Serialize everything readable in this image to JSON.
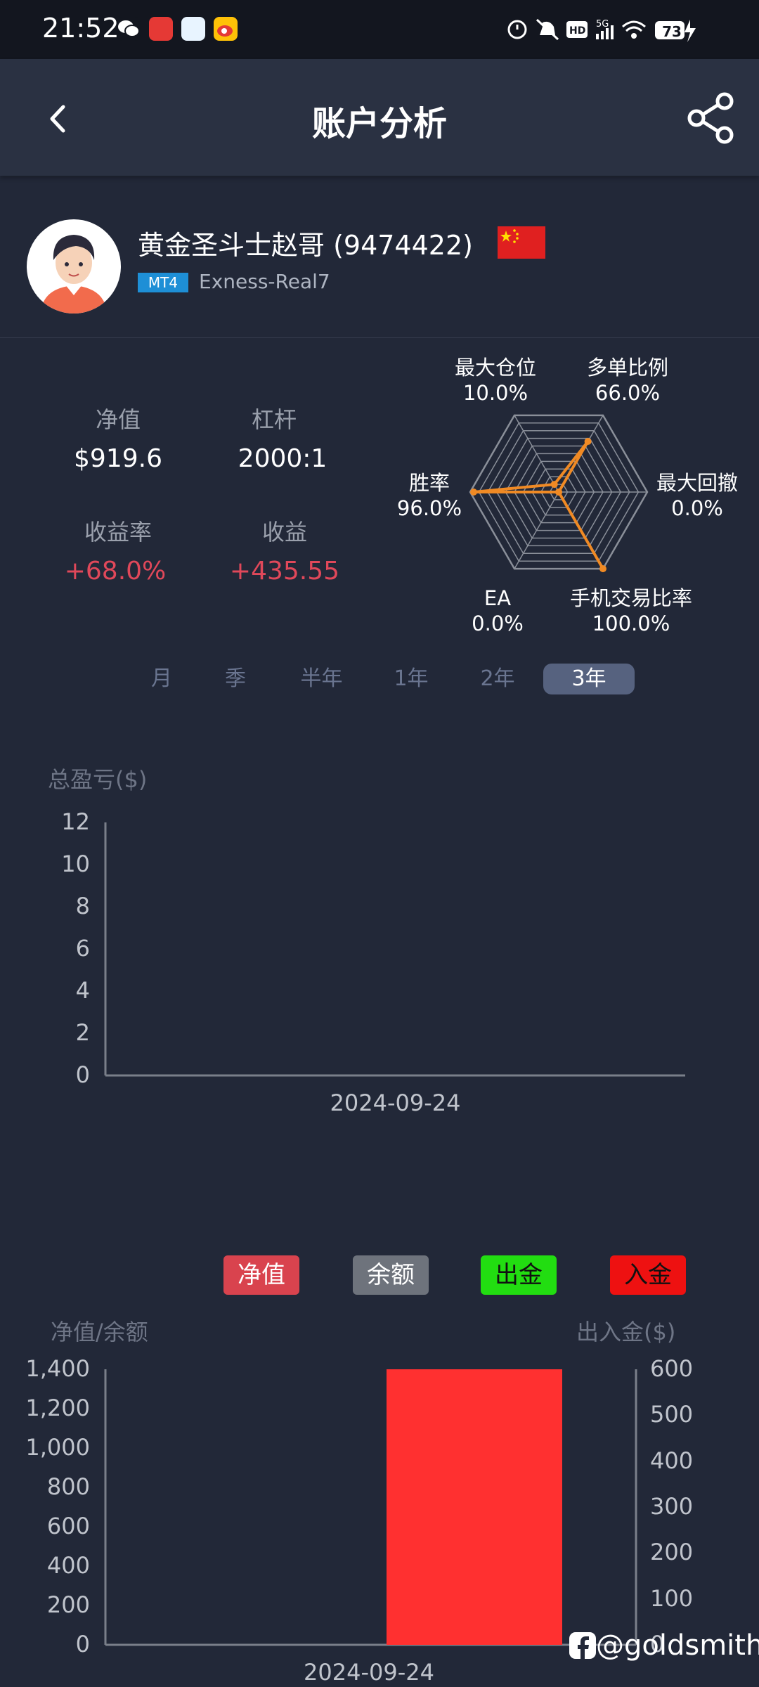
{
  "status_bar": {
    "time": "21:52",
    "battery": "73"
  },
  "header": {
    "title": "账户分析"
  },
  "profile": {
    "name": "黄金圣斗士赵哥 (9474422)",
    "platform_badge": "MT4",
    "server": "Exness-Real7"
  },
  "stats": {
    "equity_label": "净值",
    "equity_value": "$919.6",
    "leverage_label": "杠杆",
    "leverage_value": "2000:1",
    "return_rate_label": "收益率",
    "return_rate_value": "+68.0%",
    "profit_label": "收益",
    "profit_value": "+435.55"
  },
  "radar": {
    "axes": [
      {
        "label": "最大仓位",
        "value_text": "10.0%",
        "value": 10.0
      },
      {
        "label": "多单比例",
        "value_text": "66.0%",
        "value": 66.0
      },
      {
        "label": "最大回撤",
        "value_text": "0.0%",
        "value": 0.0
      },
      {
        "label": "手机交易比率",
        "value_text": "100.0%",
        "value": 100.0
      },
      {
        "label": "EA",
        "value_text": "0.0%",
        "value": 0.0
      },
      {
        "label": "胜率",
        "value_text": "96.0%",
        "value": 96.0
      }
    ],
    "line_color": "#f08a24"
  },
  "period_tabs": [
    {
      "label": "月"
    },
    {
      "label": "季"
    },
    {
      "label": "半年"
    },
    {
      "label": "1年"
    },
    {
      "label": "2年"
    },
    {
      "label": "3年",
      "active": true
    }
  ],
  "chart_data": [
    {
      "type": "bar",
      "ylabel": "总盈亏($)",
      "ylim": [
        0,
        12
      ],
      "y_ticks": [
        "12",
        "10",
        "8",
        "6",
        "4",
        "2",
        "0"
      ],
      "categories": [
        "2024-09-24"
      ],
      "values": [
        0
      ]
    },
    {
      "type": "bar",
      "ylabel_left": "净值/余额",
      "ylabel_right": "出入金($)",
      "ylim_left": [
        0,
        1400
      ],
      "ylim_right": [
        0,
        600
      ],
      "y_ticks_left": [
        "1,400",
        "1,200",
        "1,000",
        "800",
        "600",
        "400",
        "200",
        "0"
      ],
      "y_ticks_right": [
        "600",
        "500",
        "400",
        "300",
        "200",
        "100",
        "0"
      ],
      "legend": [
        {
          "label": "净值",
          "color": "#d9434e"
        },
        {
          "label": "余额",
          "color": "#6e737c"
        },
        {
          "label": "出金",
          "color": "#22dd11"
        },
        {
          "label": "入金",
          "color": "#ee1111"
        }
      ],
      "categories": [
        "2024-09-24"
      ],
      "series": [
        {
          "name": "入金",
          "axis": "right",
          "values": [
            600
          ],
          "color": "#ff3030"
        }
      ]
    }
  ],
  "watermark": "@goldsmith"
}
